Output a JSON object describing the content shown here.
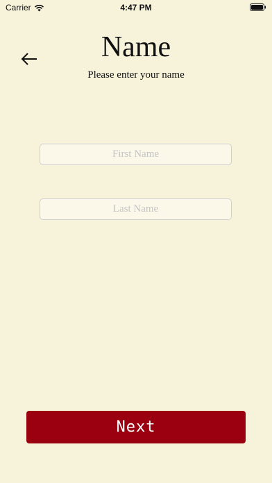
{
  "status_bar": {
    "carrier": "Carrier",
    "time": "4:47 PM",
    "wifi_icon": "wifi-icon",
    "battery_icon": "battery-icon"
  },
  "header": {
    "back_icon": "arrow-left-icon",
    "title": "Name",
    "subtitle": "Please enter your name"
  },
  "form": {
    "first_name": {
      "value": "",
      "placeholder": "First Name"
    },
    "last_name": {
      "value": "",
      "placeholder": "Last Name"
    }
  },
  "footer": {
    "next_label": "Next"
  },
  "colors": {
    "background": "#f7f3da",
    "accent": "#9b0010",
    "placeholder": "#c4c4c4"
  }
}
